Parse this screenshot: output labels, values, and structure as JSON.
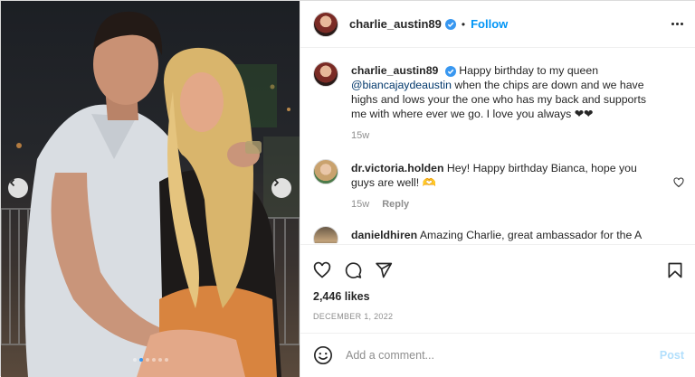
{
  "post": {
    "author": "charlie_austin89",
    "follow_label": "Follow",
    "separator": "•",
    "caption_prefix": "Happy birthday to my queen",
    "caption_mention": "@biancajaydeaustin",
    "caption_suffix": "when the chips are down and we have highs and lows your the one who has my back and supports me with where ever we go. I love you always ❤❤",
    "caption_age": "15w",
    "likes": "2,446 likes",
    "date": "DECEMBER 1, 2022",
    "carousel": {
      "slide_count": 6,
      "active_index": 1
    }
  },
  "comments": [
    {
      "user": "dr.victoria.holden",
      "text": "Hey! Happy birthday Bianca, hope you guys are well! 🫶",
      "age": "15w",
      "reply_label": "Reply"
    },
    {
      "user": "danieldhiren",
      "text": "Amazing Charlie, great ambassador for the A level ... and a legend ... part of the ... old school ... All ... best ... back"
    }
  ],
  "composer": {
    "placeholder": "Add a comment...",
    "post_label": "Post"
  },
  "icons": {
    "prev": "chevron-left-icon",
    "next": "chevron-right-icon",
    "verified": "verified-badge-icon",
    "more": "more-options-icon",
    "like": "heart-icon",
    "comment": "comment-icon",
    "share": "share-icon",
    "save": "bookmark-icon",
    "emoji": "emoji-icon"
  },
  "colors": {
    "accent": "#0095f6",
    "verified": "#3897f0",
    "muted": "#8e8e8e",
    "post_disabled": "#b2dffc"
  }
}
